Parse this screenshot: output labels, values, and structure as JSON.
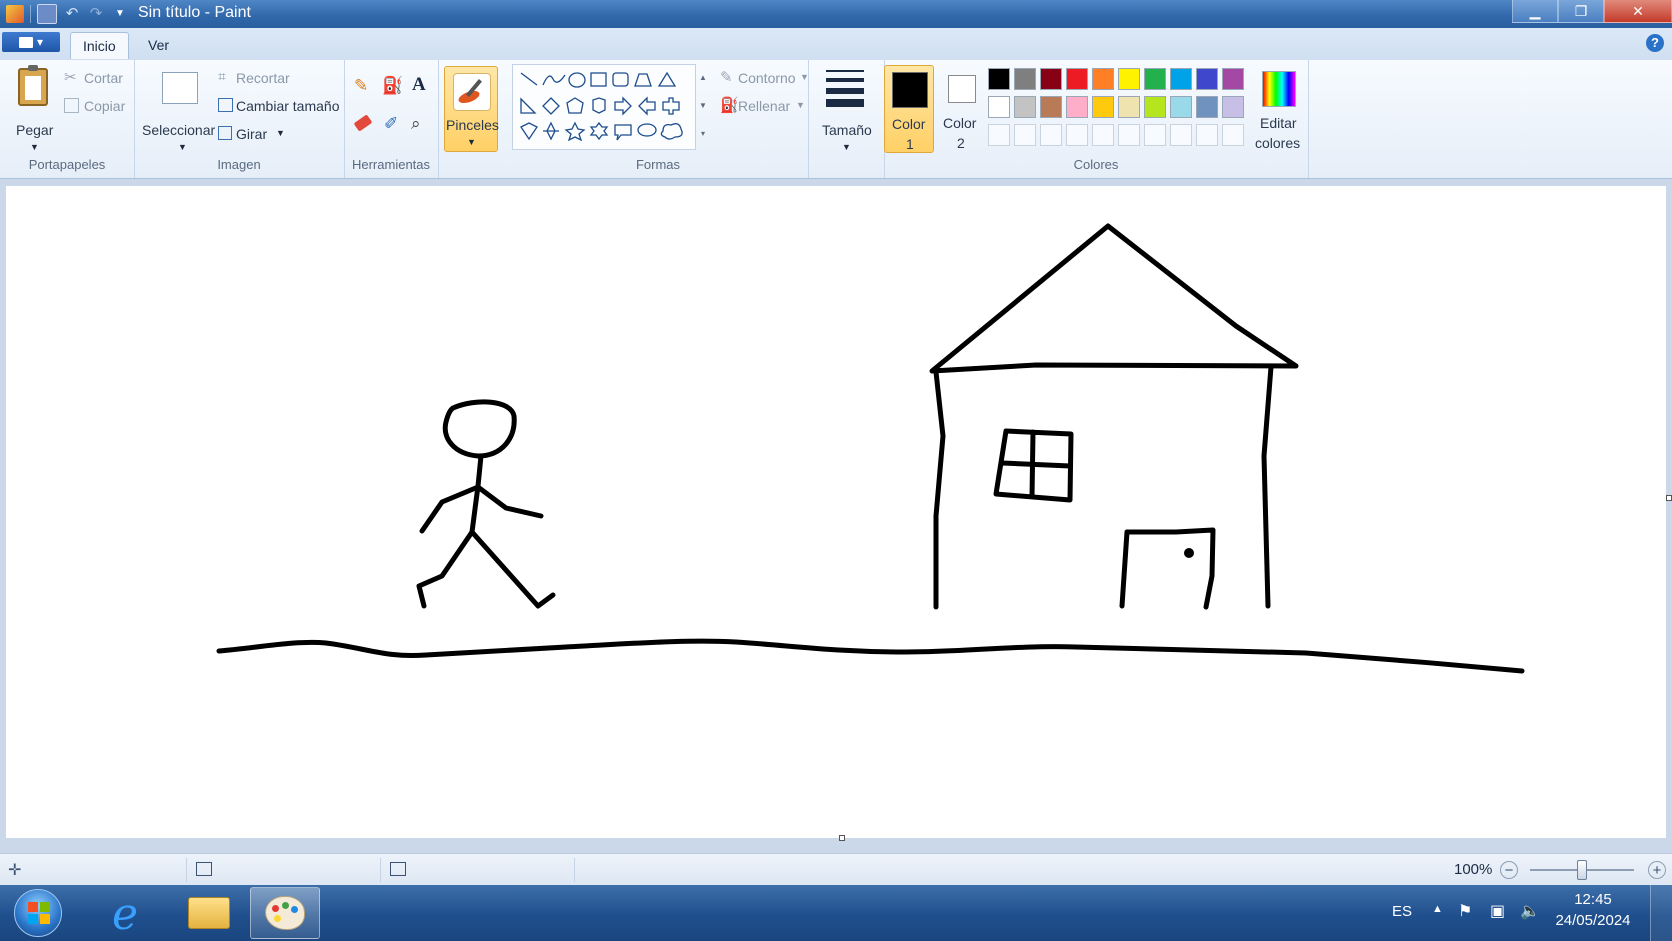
{
  "window": {
    "title": "Sin título - Paint"
  },
  "tabs": [
    "Inicio",
    "Ver"
  ],
  "groups": {
    "portapapeles": {
      "label": "Portapapeles",
      "pegar": "Pegar",
      "cortar": "Cortar",
      "copiar": "Copiar"
    },
    "imagen": {
      "label": "Imagen",
      "seleccionar": "Seleccionar",
      "recortar": "Recortar",
      "cambiar_tamano": "Cambiar tamaño",
      "girar": "Girar"
    },
    "herramientas": {
      "label": "Herramientas",
      "tools": [
        "pencil-icon",
        "fill-bucket-icon",
        "text-tool-icon",
        "eraser-icon",
        "color-picker-icon",
        "magnifier-icon"
      ]
    },
    "pinceles": {
      "label": "Pinceles"
    },
    "formas": {
      "label": "Formas",
      "contorno": "Contorno",
      "rellenar": "Rellenar"
    },
    "tamano": {
      "label": "Tamaño"
    },
    "colores": {
      "label": "Colores",
      "color1_top": "Color",
      "color1_bottom": "1",
      "color2_top": "Color",
      "color2_bottom": "2",
      "editar_top": "Editar",
      "editar_bottom": "colores",
      "color1_value": "#000000",
      "color2_value": "#ffffff",
      "palette_row1": [
        "#000000",
        "#7f7f7f",
        "#880015",
        "#ed1c24",
        "#ff7f27",
        "#fff200",
        "#22b14c",
        "#00a2e8",
        "#3f48cc",
        "#a349a4"
      ],
      "palette_row2": [
        "#ffffff",
        "#c3c3c3",
        "#b97a57",
        "#ffaec9",
        "#ffc90e",
        "#efe4b0",
        "#b5e61d",
        "#99d9ea",
        "#7092be",
        "#c8bfe7"
      ]
    }
  },
  "statusbar": {
    "zoom": "100%"
  },
  "taskbar": {
    "language": "ES",
    "time": "12:45",
    "date": "24/05/2024"
  }
}
